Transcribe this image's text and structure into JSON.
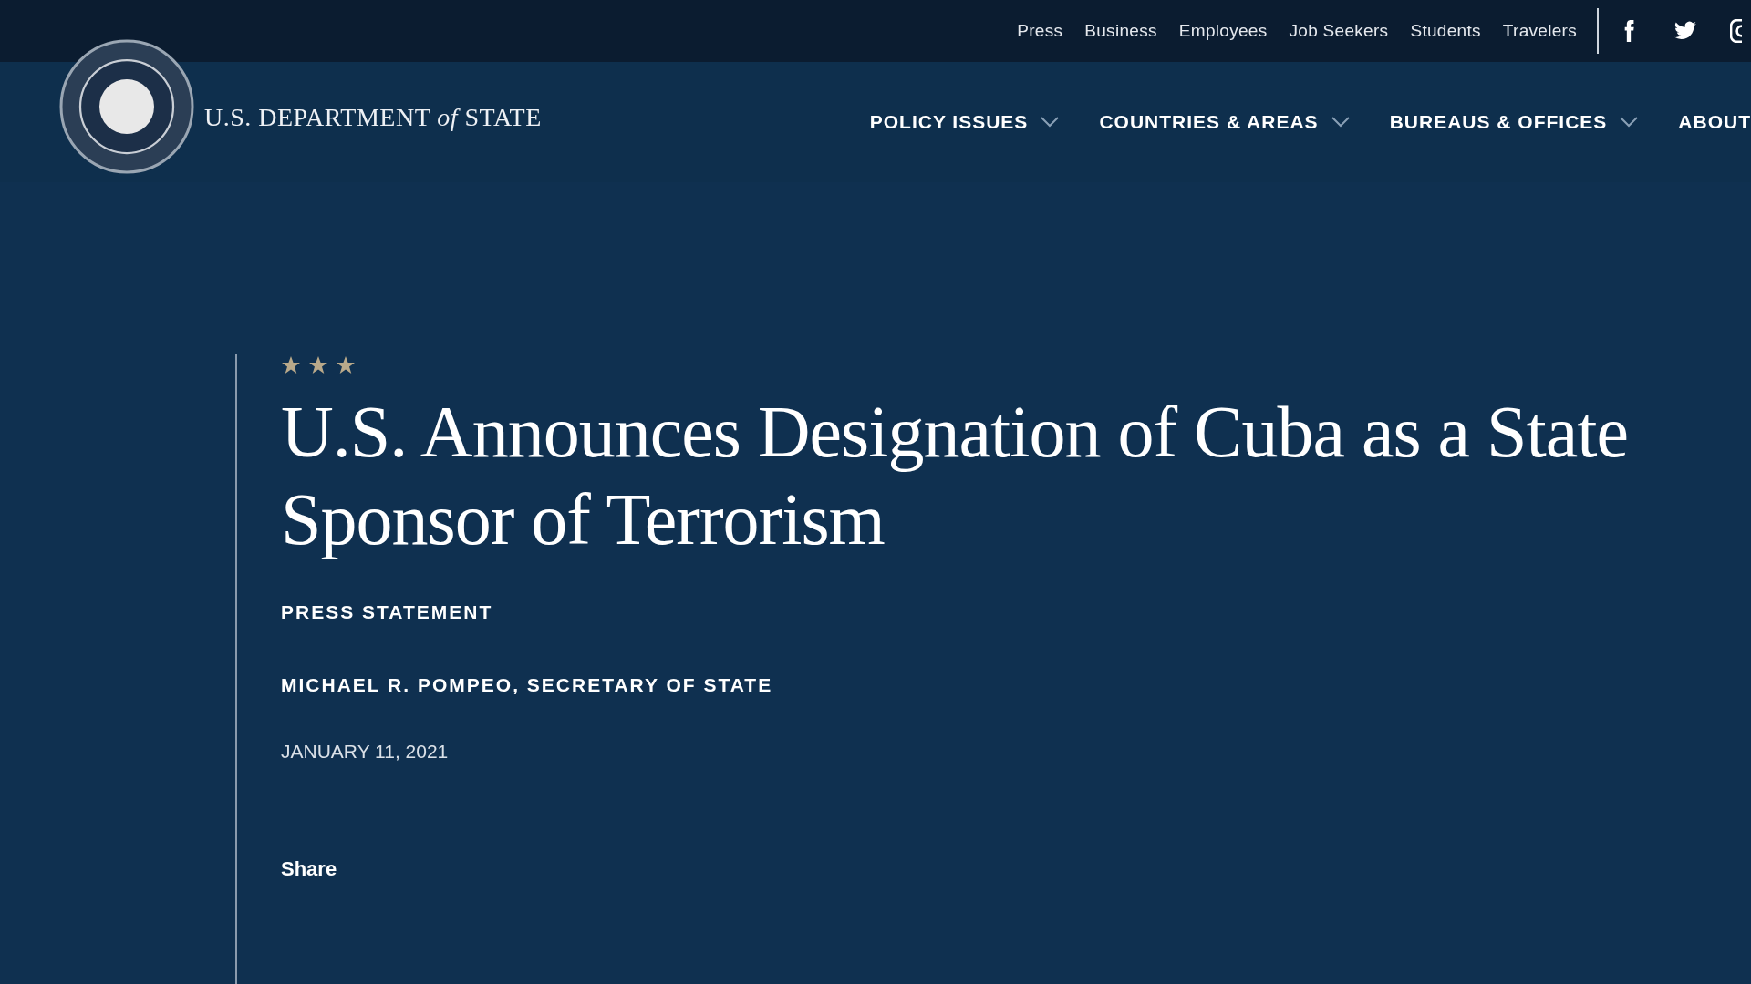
{
  "top_links": [
    "Press",
    "Business",
    "Employees",
    "Job Seekers",
    "Students",
    "Travelers"
  ],
  "site_name": "U.S. DEPARTMENT *of* STATE",
  "main_nav": [
    {
      "label": "POLICY ISSUES",
      "has_menu": true
    },
    {
      "label": "COUNTRIES & AREAS",
      "has_menu": true
    },
    {
      "label": "BUREAUS & OFFICES",
      "has_menu": true
    },
    {
      "label": "ABOUT",
      "has_menu": false
    }
  ],
  "article": {
    "title": "U.S. Announces Designation of Cuba as a State Sponsor of Terrorism",
    "type": "PRESS STATEMENT",
    "author": "MICHAEL R. POMPEO, SECRETARY OF STATE",
    "date": "JANUARY 11, 2021",
    "share": "Share"
  }
}
